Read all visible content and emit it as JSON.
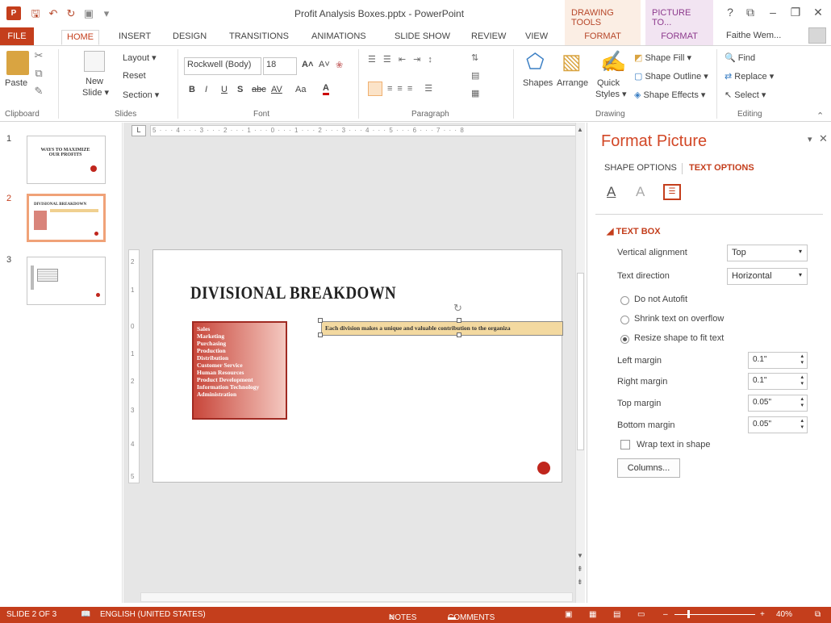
{
  "app": {
    "title": "Profit Analysis Boxes.pptx - PowerPoint",
    "logo": "P",
    "contextual_headers": [
      "DRAWING TOOLS",
      "PICTURE TO..."
    ],
    "user": "Faithe Wem...",
    "window_controls": [
      "?",
      "⧉",
      "–",
      "❐",
      "✕"
    ]
  },
  "tabs": [
    "FILE",
    "HOME",
    "INSERT",
    "DESIGN",
    "TRANSITIONS",
    "ANIMATIONS",
    "SLIDE SHOW",
    "REVIEW",
    "VIEW"
  ],
  "context_tabs": [
    "FORMAT",
    "FORMAT"
  ],
  "ribbon": {
    "clipboard": {
      "paste": "Paste",
      "label": "Clipboard"
    },
    "slides": {
      "new_slide": "New",
      "new_slide2": "Slide ▾",
      "layout": "Layout ▾",
      "reset": "Reset",
      "section": "Section ▾",
      "label": "Slides"
    },
    "font": {
      "name": "Rockwell (Body)",
      "size": "18",
      "bold": "B",
      "italic": "I",
      "underline": "U",
      "shadow": "S",
      "strike": "abc",
      "spacing": "AV",
      "case": "Aa",
      "color": "A",
      "label": "Font"
    },
    "paragraph": {
      "label": "Paragraph"
    },
    "drawing": {
      "shapes": "Shapes",
      "arrange": "Arrange",
      "quick": "Quick",
      "styles": "Styles ▾",
      "fill": "Shape Fill ▾",
      "outline": "Shape Outline ▾",
      "effects": "Shape Effects ▾",
      "label": "Drawing"
    },
    "editing": {
      "find": "Find",
      "replace": "Replace ▾",
      "select": "Select ▾",
      "label": "Editing"
    }
  },
  "thumbnails": [
    {
      "num": "1",
      "title": "WAYS TO MAXIMIZE OUR PROFITS"
    },
    {
      "num": "2",
      "title": "DIVISIONAL BREAKDOWN"
    },
    {
      "num": "3",
      "title": ""
    }
  ],
  "ruler": "5 · · · 4 · · · 3 · · · 2 · · · 1 · · · 0 · · · 1 · · · 2 · · · 3 · · · 4 · · · 5 · · · 6 · · · 7 · · · 8",
  "ruler_v": [
    "2",
    "1",
    "0",
    "1",
    "2",
    "3",
    "4",
    "5"
  ],
  "slide": {
    "title": "DIVISIONAL BREAKDOWN",
    "divisions": [
      "Sales",
      "Marketing",
      "Purchasing",
      "Production",
      "Distribution",
      "Customer Service",
      "Human Resources",
      "Product Development",
      "Information Technology",
      "Administration"
    ],
    "callout": "Each division makes a unique and valuable contribution to the organiza"
  },
  "format_pane": {
    "title": "Format Picture",
    "tab_shape": "SHAPE OPTIONS",
    "tab_text": "TEXT OPTIONS",
    "section": "TEXT BOX",
    "vertical_alignment_label": "Vertical alignment",
    "vertical_alignment": "Top",
    "text_direction_label": "Text direction",
    "text_direction": "Horizontal",
    "autofit_options": [
      "Do not Autofit",
      "Shrink text on overflow",
      "Resize shape to fit text"
    ],
    "left_margin_label": "Left margin",
    "left_margin": "0.1\"",
    "right_margin_label": "Right margin",
    "right_margin": "0.1\"",
    "top_margin_label": "Top margin",
    "top_margin": "0.05\"",
    "bottom_margin_label": "Bottom margin",
    "bottom_margin": "0.05\"",
    "wrap_label": "Wrap text in shape",
    "columns_button": "Columns..."
  },
  "status": {
    "slide": "SLIDE 2 OF 3",
    "language": "ENGLISH (UNITED STATES)",
    "notes": "NOTES",
    "comments": "COMMENTS",
    "zoom": "40%"
  },
  "colors": {
    "accent": "#c43e1c",
    "pane_title": "#d24726",
    "slide_dot": "#c0261d"
  }
}
